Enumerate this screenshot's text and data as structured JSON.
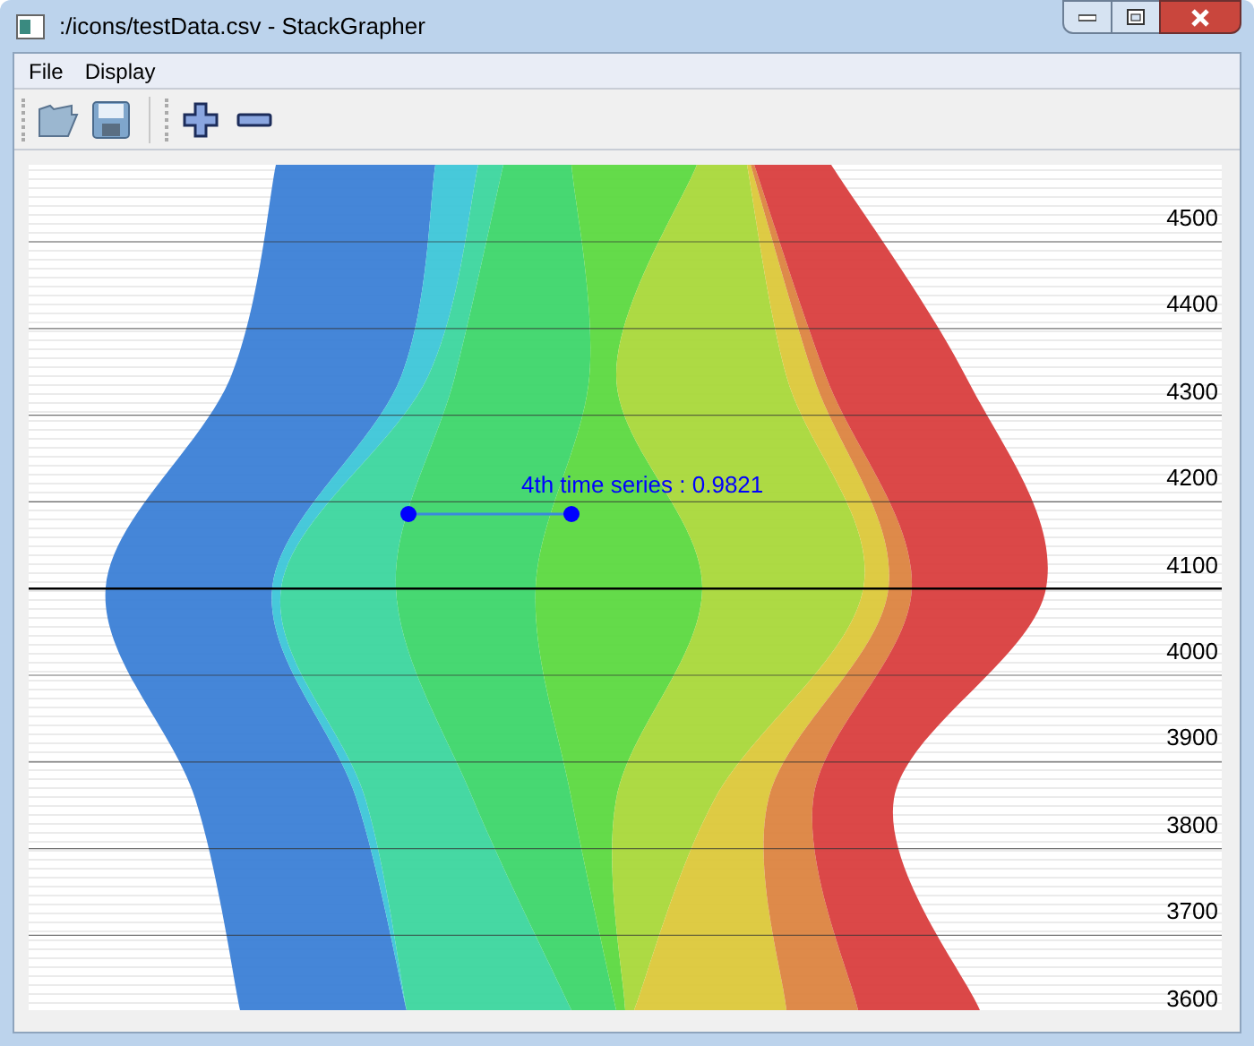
{
  "window": {
    "title": ":/icons/testData.csv - StackGrapher"
  },
  "menu": [
    {
      "label": "File"
    },
    {
      "label": "Display"
    }
  ],
  "plot": {
    "y_labels": [
      "4500",
      "4400",
      "4300",
      "4200",
      "4100",
      "4000",
      "3900",
      "3800",
      "3700",
      "3600"
    ],
    "tooltip": "4th time series : 0.9821"
  }
}
